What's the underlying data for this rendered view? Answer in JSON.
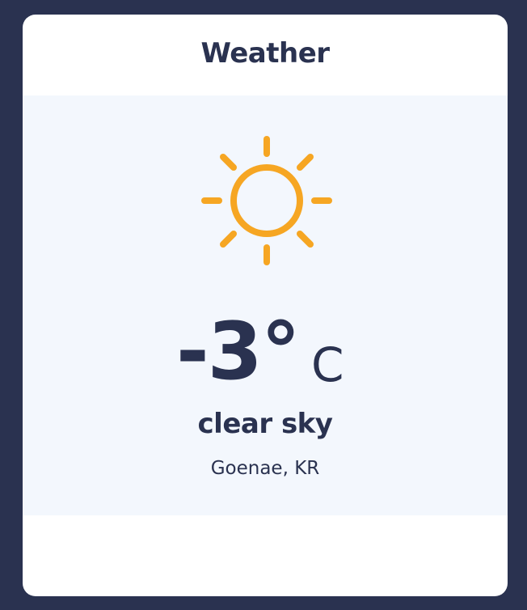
{
  "widget": {
    "title": "Weather",
    "icon": "sun-icon",
    "temperature": "-3°",
    "unit": "C",
    "condition": "clear sky",
    "location": "Goenae, KR"
  },
  "colors": {
    "background": "#2a3250",
    "card": "#ffffff",
    "panel": "#f3f7fd",
    "text": "#2a3250",
    "sun": "#f6a623"
  }
}
